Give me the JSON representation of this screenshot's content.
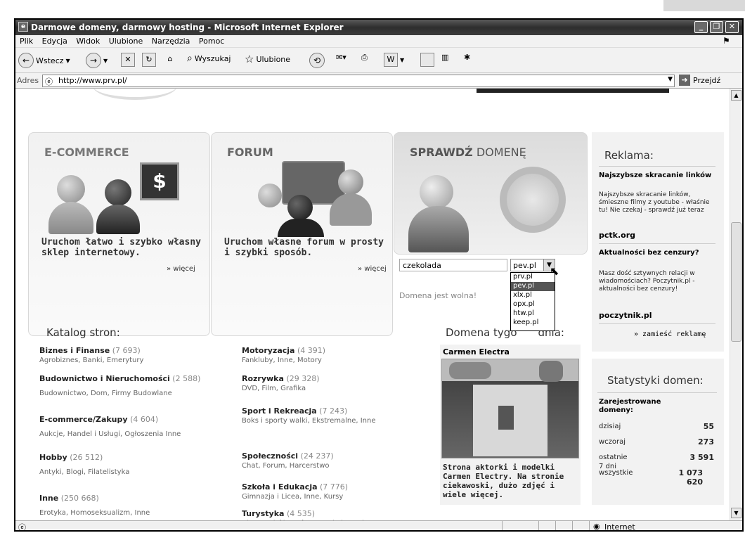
{
  "window": {
    "title": "Darmowe domeny, darmowy hosting - Microsoft Internet Explorer"
  },
  "menu": [
    "Plik",
    "Edycja",
    "Widok",
    "Ulubione",
    "Narzędzia",
    "Pomoc"
  ],
  "toolbar": {
    "back": "Wstecz",
    "search": "Wyszukaj",
    "favorites": "Ulubione"
  },
  "address": {
    "label": "Adres",
    "url": "http://www.prv.pl/",
    "go": "Przejdź"
  },
  "panels": {
    "ecommerce": {
      "title": "E-COMMERCE",
      "text": "Uruchom łatwo i szybko własny sklep internetowy.",
      "more": "» więcej"
    },
    "forum": {
      "title": "FORUM",
      "text": "Uruchom własne forum w prosty i szybki sposób.",
      "more": "» więcej"
    },
    "domain": {
      "title_bold": "SPRAWDŹ",
      "title_rest": " DOMENĘ",
      "input": "czekolada",
      "selected": "pev.pl",
      "options": [
        "prv.pl",
        "pev.pl",
        "xlx.pl",
        "opx.pl",
        "htw.pl",
        "keep.pl"
      ],
      "result": "Domena jest wolna!"
    }
  },
  "ads": {
    "header": "Reklama:",
    "items": [
      {
        "title": "Najszybsze skracanie linków",
        "text": "Najszybsze skracanie linków, śmieszne filmy z youtube - właśnie tu! Nie czekaj - sprawdź już teraz",
        "link": "pctk.org"
      },
      {
        "title": "Aktualności bez cenzury?",
        "text": "Masz dość sztywnych relacji w wiadomościach? Poczytnik.pl - aktualności bez cenzury!",
        "link": "poczytnik.pl"
      }
    ],
    "more": "» zamieść reklamę"
  },
  "catalog": {
    "header": "Katalog stron:",
    "left": [
      {
        "name": "Biznes i Finanse",
        "count": "(7 693)",
        "sub": "Agrobiznes, Banki, Emerytury"
      },
      {
        "name": "Budownictwo i Nieruchomości",
        "count": "(2 588)",
        "sub": "Budownictwo, Dom, Firmy Budowlane"
      },
      {
        "name": "E-commerce/Zakupy",
        "count": "(4 604)",
        "sub": "Aukcje, Handel i Usługi, Ogłoszenia Inne"
      },
      {
        "name": "Hobby",
        "count": "(26 512)",
        "sub": "Antyki, Blogi, Filatelistyka"
      },
      {
        "name": "Inne",
        "count": "(250 668)",
        "sub": "Erotyka, Homoseksualizm, Inne"
      }
    ],
    "right": [
      {
        "name": "Motoryzacja",
        "count": "(4 391)",
        "sub": "Fankluby, Inne, Motory"
      },
      {
        "name": "Rozrywka",
        "count": "(29 328)",
        "sub": "DVD, Film, Grafika"
      },
      {
        "name": "Sport i Rekreacja",
        "count": "(7 243)",
        "sub": "Boks i sporty walki, Ekstremalne, Inne"
      },
      {
        "name": "Społeczności",
        "count": "(24 237)",
        "sub": "Chat, Forum, Harcerstwo"
      },
      {
        "name": "Szkoła i Edukacja",
        "count": "(7 776)",
        "sub": "Gimnazja i Licea, Inne, Kursy"
      },
      {
        "name": "Turystyka",
        "count": "(4 535)",
        "sub": "Biura Podróży, Góry, Hotele i pensjonaty"
      }
    ]
  },
  "domain_week": {
    "header_a": "Domena tygo",
    "header_b": "dnia:",
    "name": "Carmen Electra",
    "desc": "Strona aktorki i modelki Carmen Electry. Na stronie ciekawoski, dużo zdjęć i wiele więcej."
  },
  "stats": {
    "header": "Statystyki domen:",
    "subheader": "Zarejestrowane domeny:",
    "rows": [
      {
        "label": "dzisiaj",
        "value": "55"
      },
      {
        "label": "wczoraj",
        "value": "273"
      },
      {
        "label": "ostatnie 7 dni",
        "value": "3 591"
      },
      {
        "label": "wszystkie",
        "value": "1 073 620"
      }
    ]
  },
  "status": {
    "zone": "Internet"
  }
}
